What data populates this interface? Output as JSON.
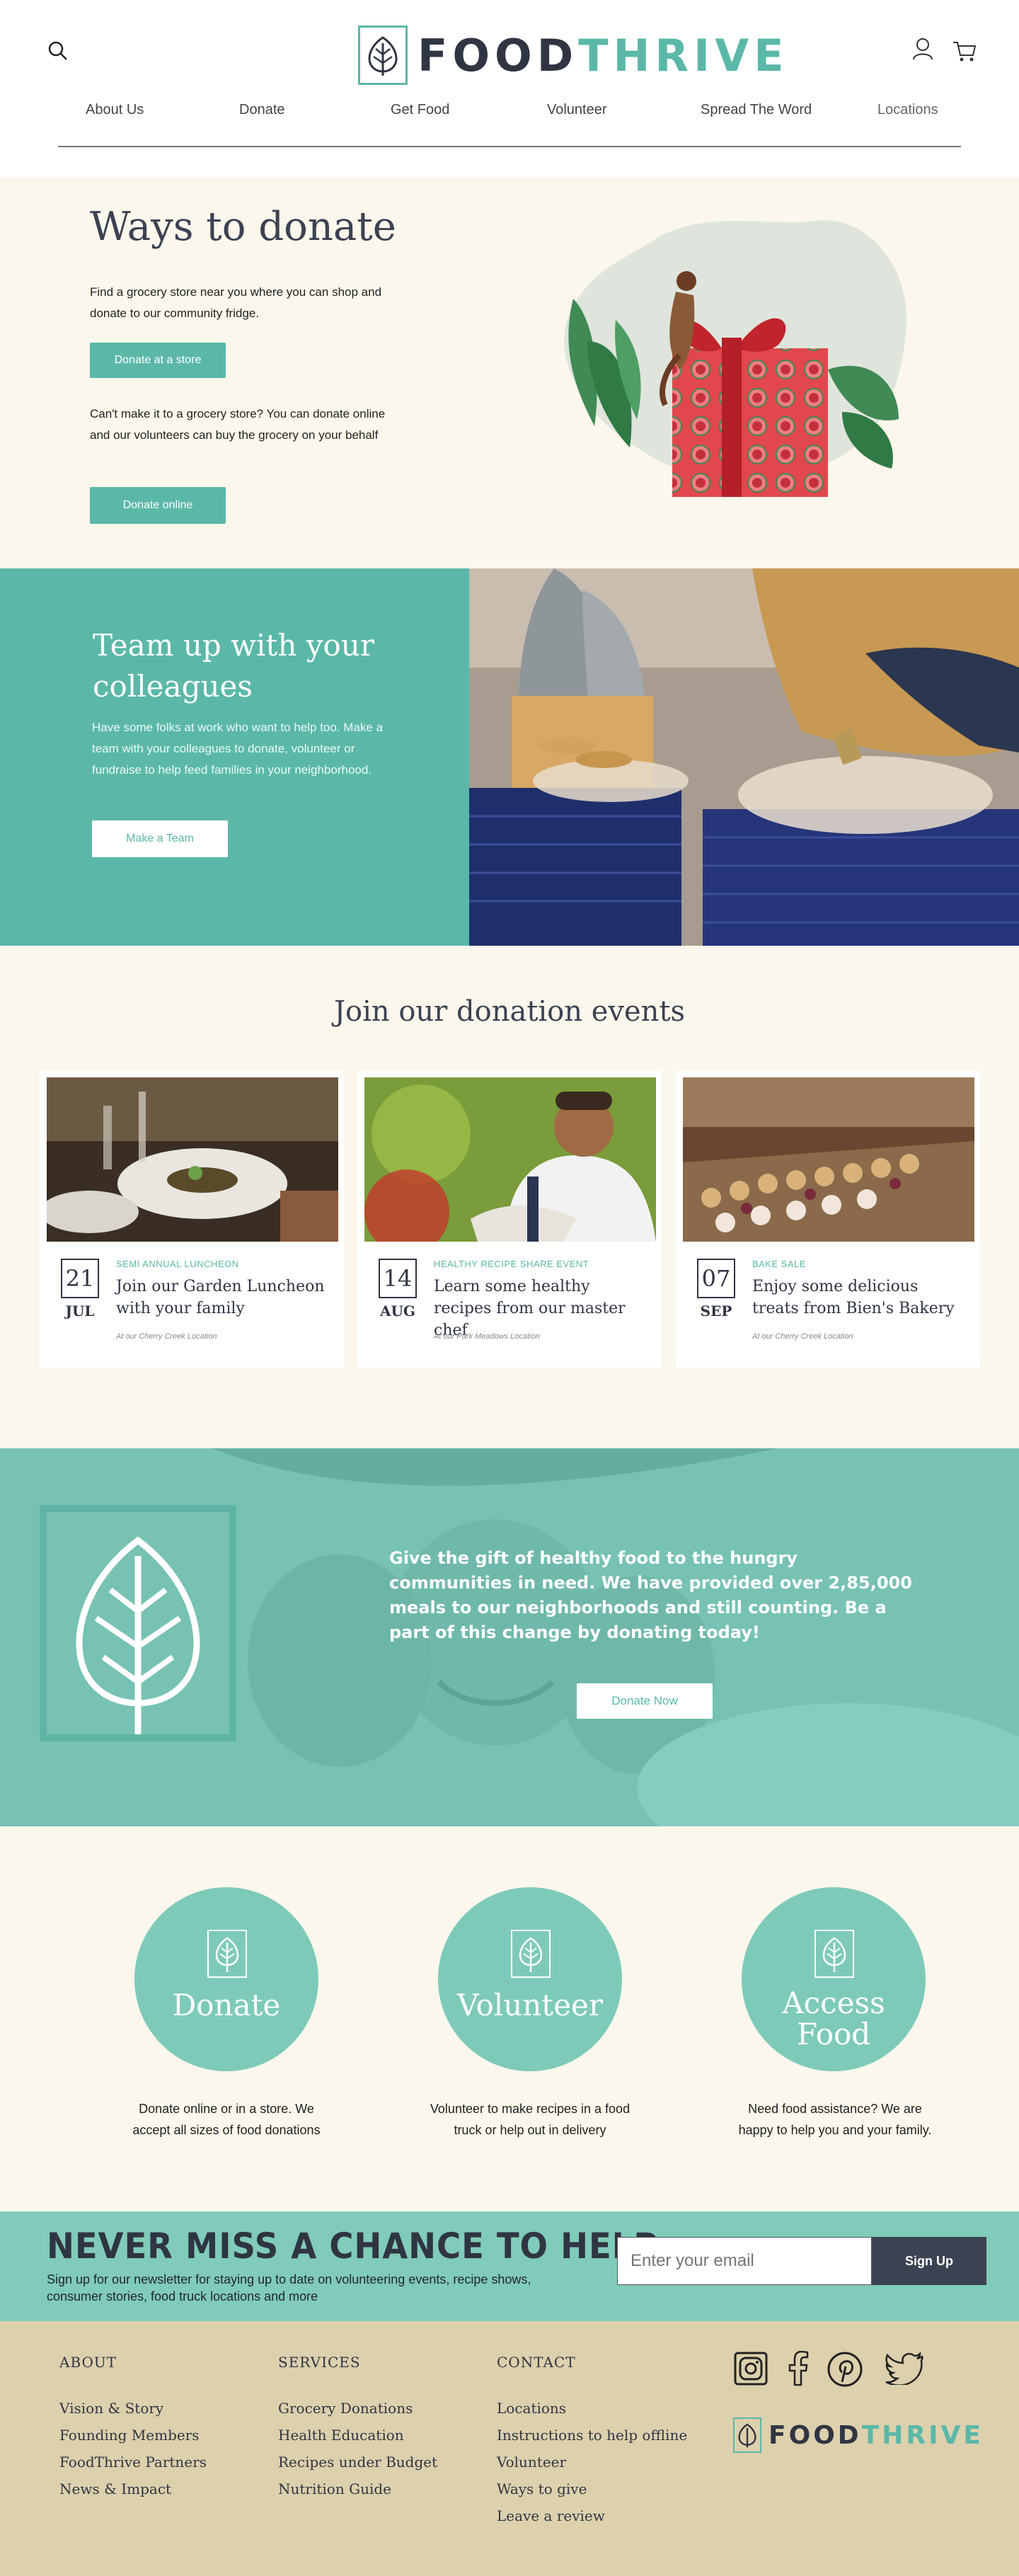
{
  "brand": {
    "name_part1": "FOOD",
    "name_part2": "THRIVE",
    "accent": "#5bb8a8",
    "dark": "#2f3542",
    "cream": "#fbf7ec",
    "sand": "#ddd0ad"
  },
  "header": {
    "icons": [
      "search-icon",
      "user-icon",
      "cart-icon"
    ],
    "nav": [
      "About Us",
      "Donate",
      "Get Food",
      "Volunteer",
      "Spread The Word",
      "Locations"
    ]
  },
  "ways": {
    "title": "Ways to donate",
    "store_text": "Find a grocery store near you where you can shop and donate to our community fridge.",
    "store_button": "Donate at a store",
    "online_text": "Can't make it to a grocery store? You can donate online and our volunteers can buy the grocery on your behalf",
    "online_button": "Donate online"
  },
  "team": {
    "title": "Team up with your colleagues",
    "text": "Have some folks at work who want to help too. Make a team with your colleagues to donate, volunteer or fundraise to help feed families in your neighborhood.",
    "button": "Make a Team"
  },
  "events": {
    "title": "Join our donation events",
    "cards": [
      {
        "day": "21",
        "month": "JUL",
        "category": "SEMI ANNUAL LUNCHEON",
        "title": "Join our Garden Luncheon with your family",
        "location": "At our Cherry Creek Location"
      },
      {
        "day": "14",
        "month": "AUG",
        "category": "HEALTHY RECIPE SHARE EVENT",
        "title": "Learn some healthy recipes from our master chef",
        "location": "At our Park Meadows Location"
      },
      {
        "day": "07",
        "month": "SEP",
        "category": "BAKE SALE",
        "title": "Enjoy some delicious treats from Bien's Bakery",
        "location": "At our Cherry Creek Location"
      }
    ]
  },
  "cta": {
    "text": "Give the gift of healthy food to the hungry communities in need. We have provided over 2,85,000 meals to our neighborhoods and still counting. Be a part of this change by donating today!",
    "button": "Donate Now"
  },
  "actions": [
    {
      "label": "Donate",
      "desc": "Donate online or in a store. We accept all sizes of food donations"
    },
    {
      "label": "Volunteer",
      "desc": "Volunteer to make recipes in a food truck or help out in delivery"
    },
    {
      "label": "Access Food",
      "desc": "Need food assistance? We are happy to help you and your family."
    }
  ],
  "newsletter": {
    "headline": "NEVER MISS A CHANCE TO HELP",
    "sub": "Sign up for our newsletter for staying up to date on volunteering events, recipe shows, consumer stories, food truck locations and more",
    "placeholder": "Enter your email",
    "button": "Sign Up"
  },
  "footer": {
    "about": {
      "heading": "ABOUT",
      "items": [
        "Vision & Story",
        "Founding Members",
        "FoodThrive Partners",
        "News & Impact"
      ]
    },
    "services": {
      "heading": "SERVICES",
      "items": [
        "Grocery Donations",
        "Health Education",
        "Recipes under Budget",
        "Nutrition Guide"
      ]
    },
    "contact": {
      "heading": "CONTACT",
      "items": [
        "Locations",
        "Instructions to help offline",
        "Volunteer",
        "Ways to give",
        "Leave a review"
      ]
    },
    "social": [
      "instagram-icon",
      "facebook-icon",
      "pinterest-icon",
      "twitter-icon"
    ]
  }
}
